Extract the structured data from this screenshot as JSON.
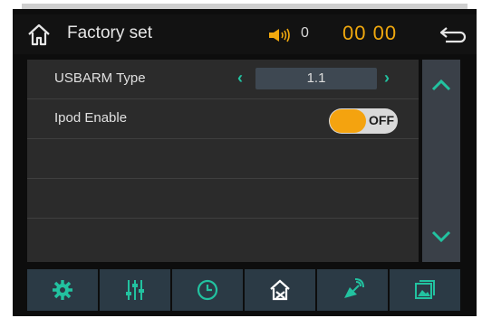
{
  "header": {
    "title": "Factory set",
    "volume": "0",
    "time": "00 00",
    "icons": [
      "home-icon",
      "speaker-icon",
      "back-icon"
    ]
  },
  "settings": {
    "rows": [
      {
        "label": "USBARM Type",
        "value": "1.1",
        "control": "stepper"
      },
      {
        "label": "Ipod Enable",
        "value": "OFF",
        "control": "toggle"
      }
    ]
  },
  "tabs": [
    "gear-icon",
    "equalizer-icon",
    "clock-icon",
    "factory-settings-icon",
    "satellite-icon",
    "gallery-icon"
  ],
  "colors": {
    "accent_orange": "#f4a30f",
    "accent_teal": "#22c2a0",
    "time_color": "#f0a80e",
    "tab_background": "#2b3a45",
    "panel_background": "#2b2b2b"
  }
}
